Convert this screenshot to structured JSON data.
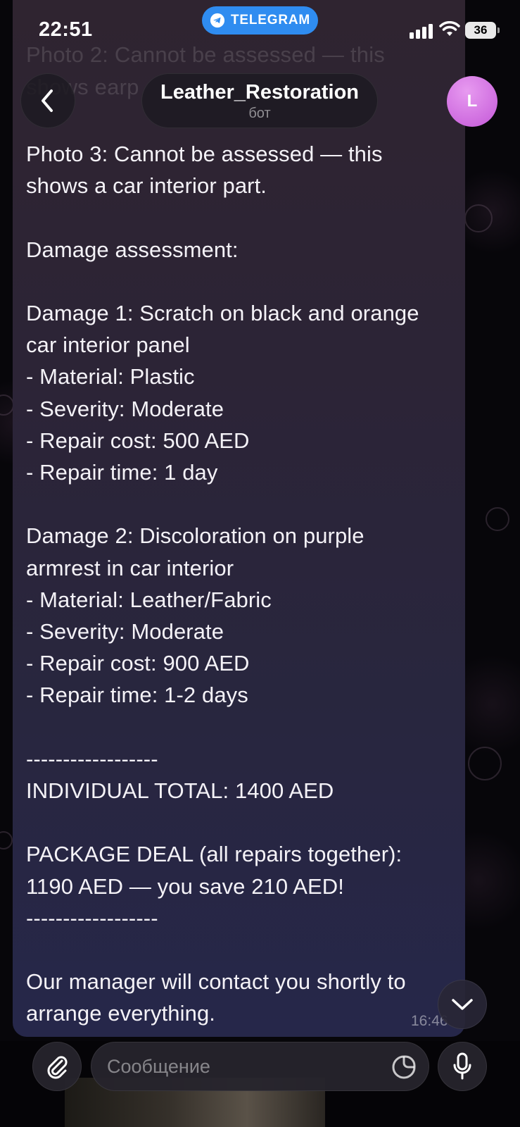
{
  "status_bar": {
    "time": "22:51",
    "app_pill": "TELEGRAM",
    "battery": "36"
  },
  "header": {
    "title": "Leather_Restoration",
    "subtitle": "бот",
    "avatar_letter": "L"
  },
  "faded_lines": [
    "Photo 2: Cannot be assessed — this",
    "shows earp"
  ],
  "message": {
    "text": "Photo 3: Cannot be assessed — this\nshows a car interior part.\n\nDamage assessment:\n\nDamage 1: Scratch on black and orange\ncar interior panel\n- Material: Plastic\n- Severity: Moderate\n- Repair cost: 500 AED\n- Repair time: 1 day\n\nDamage 2: Discoloration on purple\narmrest in car interior\n- Material: Leather/Fabric\n- Severity: Moderate\n- Repair cost: 900 AED\n- Repair time: 1-2 days\n\n------------------\nINDIVIDUAL TOTAL: 1400 AED\n\nPACKAGE DEAL (all repairs together):\n1190 AED — you save 210 AED!\n------------------\n\nOur manager will contact you shortly to\narrange everything.",
    "time": "16:46"
  },
  "input": {
    "placeholder": "Сообщение"
  },
  "icons": {
    "back": "chevron-left-icon",
    "scroll": "chevron-down-icon",
    "attach": "paperclip-icon",
    "sticker": "sticker-icon",
    "mic": "microphone-icon",
    "telegram": "telegram-plane-icon"
  },
  "colors": {
    "telegram_blue": "#2f8cf0",
    "avatar": "#d977e6",
    "bubble_top": "#2f2430",
    "bubble_bottom": "#26274a"
  }
}
